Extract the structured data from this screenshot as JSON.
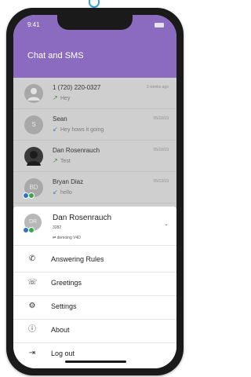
{
  "status_bar": {
    "time": "9:41"
  },
  "header": {
    "title": "Chat and SMS"
  },
  "conversations": [
    {
      "name": "1 (720) 220-0327",
      "message": "Hey",
      "direction": "outgoing",
      "date": "3 weeks ago"
    },
    {
      "name": "Sean",
      "initials": "S",
      "message": "Hey hows it going",
      "direction": "incoming",
      "date": "05/10/19"
    },
    {
      "name": "Dan Rosenrauch",
      "message": "Test",
      "direction": "outgoing",
      "date": "05/10/19"
    },
    {
      "name": "Bryan Diaz",
      "initials": "BD",
      "message": "hello",
      "direction": "incoming",
      "date": "05/13/19"
    }
  ],
  "account": {
    "initials": "DR",
    "name": "Dan Rosenrauch",
    "extension": "3282",
    "device": "demoing V4D"
  },
  "menu": [
    {
      "label": "Answering Rules",
      "icon": "voicemail-call-icon"
    },
    {
      "label": "Greetings",
      "icon": "greeting-phone-icon"
    },
    {
      "label": "Settings",
      "icon": "gear-icon"
    },
    {
      "label": "About",
      "icon": "info-icon"
    },
    {
      "label": "Log out",
      "icon": "logout-icon"
    }
  ],
  "colors": {
    "header": "#8a6bbf",
    "outgoing_arrow": "#3c8f3c",
    "incoming_arrow": "#3f7fb8"
  }
}
